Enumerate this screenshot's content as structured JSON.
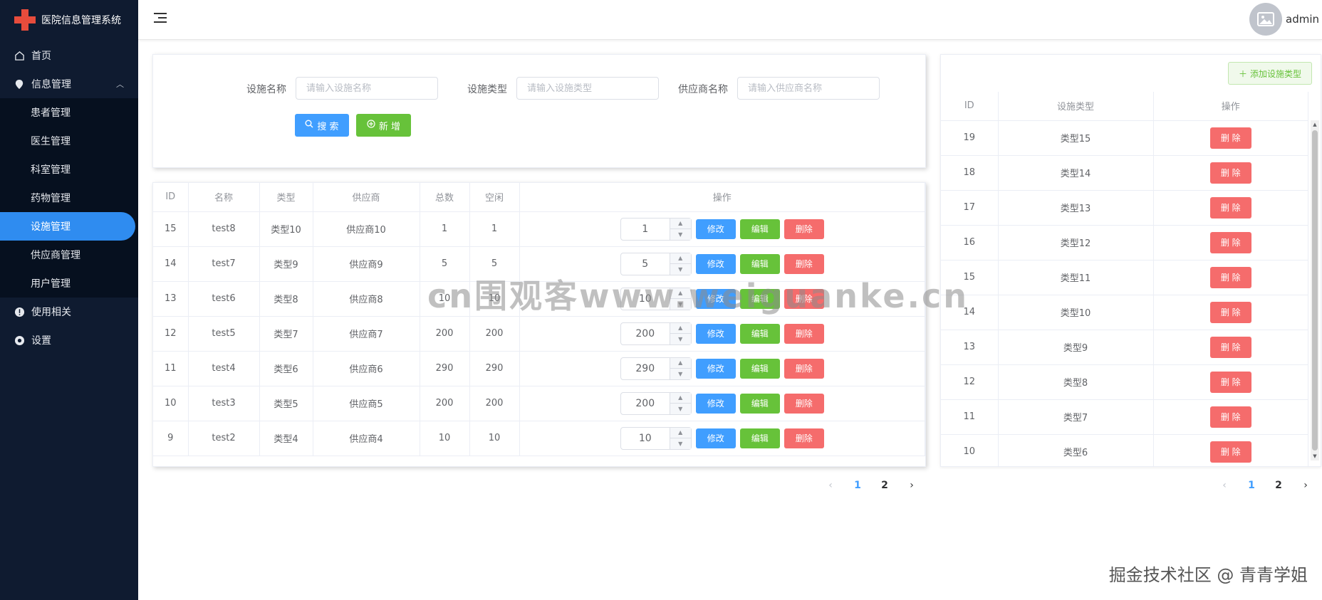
{
  "app": {
    "title": "医院信息管理系统"
  },
  "sidebar": {
    "items": [
      {
        "label": "首页",
        "icon": "home-icon"
      },
      {
        "label": "信息管理",
        "icon": "location-icon",
        "expanded": true,
        "children": [
          {
            "label": "患者管理"
          },
          {
            "label": "医生管理"
          },
          {
            "label": "科室管理"
          },
          {
            "label": "药物管理"
          },
          {
            "label": "设施管理",
            "active": true
          },
          {
            "label": "供应商管理"
          },
          {
            "label": "用户管理"
          }
        ]
      },
      {
        "label": "使用相关",
        "icon": "warning-icon"
      },
      {
        "label": "设置",
        "icon": "setting-icon"
      }
    ]
  },
  "header": {
    "user": "admin"
  },
  "search": {
    "name_label": "设施名称",
    "name_placeholder": "请输入设施名称",
    "type_label": "设施类型",
    "type_placeholder": "请输入设施类型",
    "supplier_label": "供应商名称",
    "supplier_placeholder": "请输入供应商名称",
    "search_btn": "搜 索",
    "add_btn": "新 增"
  },
  "facility_table": {
    "columns": [
      "ID",
      "名称",
      "类型",
      "供应商",
      "总数",
      "空闲",
      "操作"
    ],
    "action_labels": {
      "modify": "修改",
      "edit": "编辑",
      "delete": "删除"
    },
    "rows": [
      {
        "id": "15",
        "name": "test8",
        "type": "类型10",
        "supplier": "供应商10",
        "total": "1",
        "free": "1",
        "stepper": "1"
      },
      {
        "id": "14",
        "name": "test7",
        "type": "类型9",
        "supplier": "供应商9",
        "total": "5",
        "free": "5",
        "stepper": "5"
      },
      {
        "id": "13",
        "name": "test6",
        "type": "类型8",
        "supplier": "供应商8",
        "total": "10",
        "free": "10",
        "stepper": "10"
      },
      {
        "id": "12",
        "name": "test5",
        "type": "类型7",
        "supplier": "供应商7",
        "total": "200",
        "free": "200",
        "stepper": "200"
      },
      {
        "id": "11",
        "name": "test4",
        "type": "类型6",
        "supplier": "供应商6",
        "total": "290",
        "free": "290",
        "stepper": "290"
      },
      {
        "id": "10",
        "name": "test3",
        "type": "类型5",
        "supplier": "供应商5",
        "total": "200",
        "free": "200",
        "stepper": "200"
      },
      {
        "id": "9",
        "name": "test2",
        "type": "类型4",
        "supplier": "供应商4",
        "total": "10",
        "free": "10",
        "stepper": "10"
      }
    ],
    "pagination": {
      "pages": [
        "1",
        "2"
      ],
      "current": "1"
    }
  },
  "type_panel": {
    "add_btn": "添加设施类型",
    "columns": [
      "ID",
      "设施类型",
      "操作"
    ],
    "delete_label": "删 除",
    "rows": [
      {
        "id": "19",
        "type": "类型15"
      },
      {
        "id": "18",
        "type": "类型14"
      },
      {
        "id": "17",
        "type": "类型13"
      },
      {
        "id": "16",
        "type": "类型12"
      },
      {
        "id": "15",
        "type": "类型11"
      },
      {
        "id": "14",
        "type": "类型10"
      },
      {
        "id": "13",
        "type": "类型9"
      },
      {
        "id": "12",
        "type": "类型8"
      },
      {
        "id": "11",
        "type": "类型7"
      },
      {
        "id": "10",
        "type": "类型6"
      }
    ],
    "pagination": {
      "pages": [
        "1",
        "2"
      ],
      "current": "1"
    }
  },
  "watermarks": {
    "center": "cn围观客www.weiguanke.cn",
    "corner": "掘金技术社区 @ 青青学姐"
  },
  "colors": {
    "primary": "#409eff",
    "success": "#67c23a",
    "danger": "#f56c6c",
    "sidebar": "#0f1b30"
  }
}
